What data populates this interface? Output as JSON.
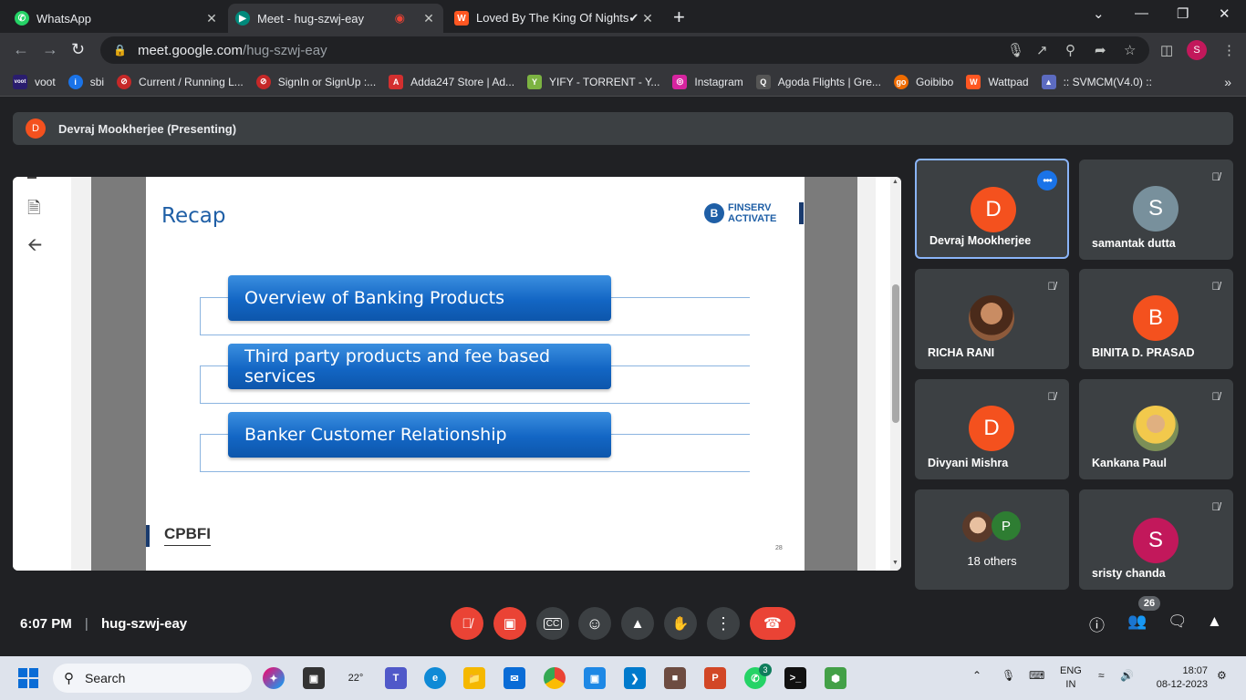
{
  "browser": {
    "tabs": [
      {
        "title": "WhatsApp",
        "icon": "whatsapp-icon",
        "color": "#25d366"
      },
      {
        "title": "Meet - hug-szwj-eay",
        "icon": "google-meet-icon",
        "color": "#00897b"
      },
      {
        "title": "Loved By The King Of Nights✔",
        "icon": "wattpad-icon",
        "color": "#ff5722"
      }
    ],
    "url_host": "meet.google.com",
    "url_path": "/hug-szwj-eay",
    "profile_initial": "S"
  },
  "bookmarks": [
    {
      "label": "voot",
      "color": "#2a1d6e",
      "glyph": "voot"
    },
    {
      "label": "sbi",
      "color": "#1a73e8",
      "glyph": "i"
    },
    {
      "label": "Current / Running L...",
      "color": "#c62828",
      "glyph": "⊘"
    },
    {
      "label": "SignIn or SignUp :...",
      "color": "#c62828",
      "glyph": "⊘"
    },
    {
      "label": "Adda247 Store | Ad...",
      "color": "#d32f2f",
      "glyph": "A"
    },
    {
      "label": "YIFY - TORRENT - Y...",
      "color": "#7cb342",
      "glyph": "Y"
    },
    {
      "label": "Instagram",
      "color": "#d6249f",
      "glyph": "◎"
    },
    {
      "label": "Agoda Flights | Gre...",
      "color": "#555555",
      "glyph": "Q"
    },
    {
      "label": "Goibibo",
      "color": "#ef6c00",
      "glyph": "go"
    },
    {
      "label": "Wattpad",
      "color": "#ff5722",
      "glyph": "W"
    },
    {
      "label": ":: SVMCM(V4.0) ::",
      "color": "#5c6bc0",
      "glyph": "▲"
    }
  ],
  "meeting": {
    "presenter_initial": "D",
    "presenter_label": "Devraj Mookherjee (Presenting)",
    "time": "6:07 PM",
    "code": "hug-szwj-eay",
    "participant_count": "26"
  },
  "slide": {
    "title": "Recap",
    "logo_line1": "FINSERV",
    "logo_line2": "ACTIVATE",
    "items": [
      "Overview of Banking Products",
      "Third party products and fee based services",
      "Banker Customer Relationship"
    ],
    "footer": "CPBFI",
    "page_number": "28"
  },
  "participants": [
    {
      "name": "Devraj Mookherjee",
      "initial": "D",
      "color": "#f4511e",
      "muted": false
    },
    {
      "name": "samantak dutta",
      "initial": "S",
      "color": "#78909c",
      "muted": true
    },
    {
      "name": "RICHA RANI",
      "initial": "",
      "color": "#8d5a3b",
      "muted": true
    },
    {
      "name": "BINITA D. PRASAD",
      "initial": "B",
      "color": "#f4511e",
      "muted": true
    },
    {
      "name": "Divyani Mishra",
      "initial": "D",
      "color": "#f4511e",
      "muted": true
    },
    {
      "name": "Kankana Paul",
      "initial": "",
      "color": "#7c8f57",
      "muted": true
    },
    {
      "name": "18 others",
      "initial": "P",
      "color": "#2e7d32",
      "muted": false
    },
    {
      "name": "sristy chanda",
      "initial": "S",
      "color": "#c2185b",
      "muted": true
    }
  ],
  "taskbar": {
    "search_label": "Search",
    "weather": "22°",
    "whatsapp_badge": "3",
    "lang_line1": "ENG",
    "lang_line2": "IN",
    "clock_time": "18:07",
    "clock_date": "08-12-2023"
  }
}
